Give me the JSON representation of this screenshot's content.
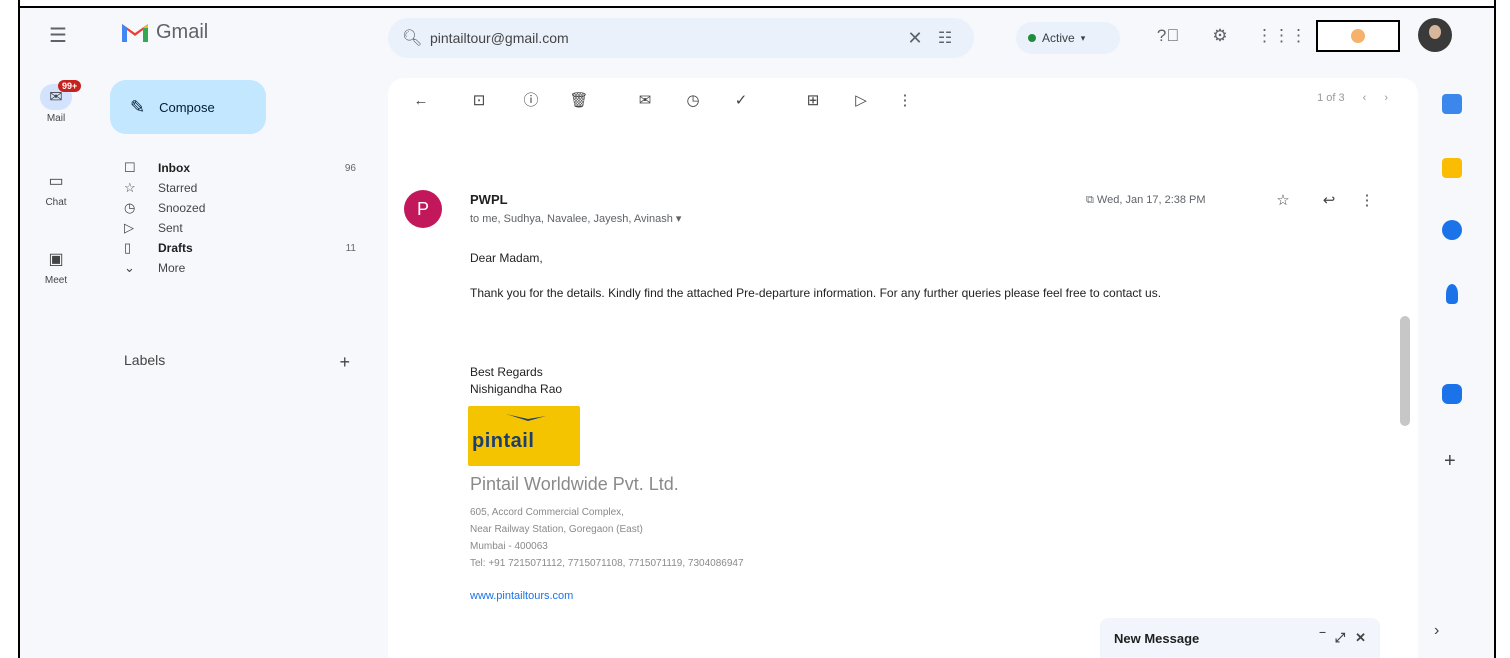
{
  "app": {
    "name": "Gmail"
  },
  "search": {
    "value": "pintailtour@gmail.com"
  },
  "status": {
    "label": "Active"
  },
  "rail": {
    "mail": {
      "label": "Mail",
      "badge": "99+"
    },
    "chat": {
      "label": "Chat"
    },
    "meet": {
      "label": "Meet"
    }
  },
  "compose": {
    "label": "Compose"
  },
  "nav": [
    {
      "label": "Inbox",
      "count": "96",
      "icon": "inbox-icon"
    },
    {
      "label": "Starred",
      "count": "",
      "icon": "star-icon"
    },
    {
      "label": "Snoozed",
      "count": "",
      "icon": "clock-icon"
    },
    {
      "label": "Sent",
      "count": "",
      "icon": "send-icon"
    },
    {
      "label": "Drafts",
      "count": "11",
      "icon": "draft-icon"
    },
    {
      "label": "More",
      "count": "",
      "icon": "chevron-down-icon"
    }
  ],
  "labels": {
    "title": "Labels"
  },
  "pager": {
    "range": "1 of 3"
  },
  "email": {
    "sender": "PWPL",
    "avatar_letter": "P",
    "to": "to me, Sudhya, Navalee, Jayesh, Avinash",
    "date": "Wed, Jan 17, 2:38 PM",
    "greeting": "Dear Madam,",
    "para": "Thank you for the details. Kindly find the attached Pre-departure information. For any further queries please feel free to contact us.",
    "regards": "Best Regards",
    "signer": "Nishigandha Rao",
    "logo_word": "pintail",
    "company": "Pintail Worldwide Pvt. Ltd.",
    "addr1": "605, Accord Commercial Complex,",
    "addr2": "Near Railway Station, Goregaon (East)",
    "addr3": "Mumbai - 400063",
    "phone": "Tel: +91 7215071112, 7715071108, 7715071119, 7304086947",
    "website": "www.pintailtours.com"
  },
  "new_message": {
    "title": "New Message"
  },
  "colors": {
    "accent": "#c2e7ff",
    "avatar": "#c2185b",
    "logo_bg": "#f5c400",
    "active": "#1e8e3e"
  }
}
